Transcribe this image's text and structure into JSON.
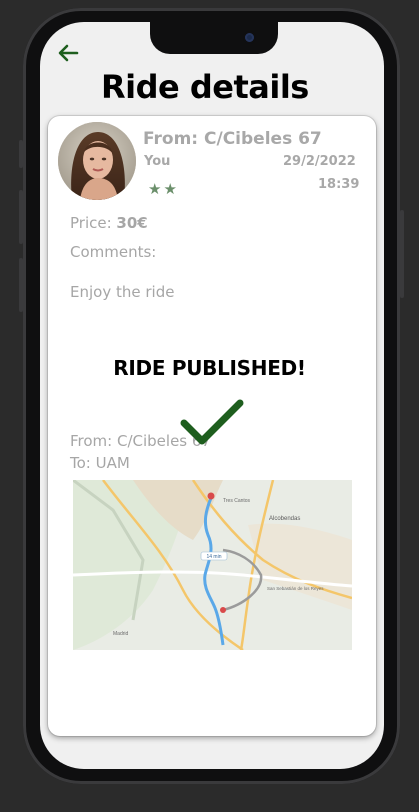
{
  "header": {
    "title": "Ride details"
  },
  "ride": {
    "from_title": "From: C/Cibeles 67",
    "driver": "You",
    "date": "29/2/2022",
    "time": "18:39",
    "stars": "★★",
    "price_label": "Price: ",
    "price_value": "30€",
    "comments_label": "Comments:",
    "comments": "Enjoy the ride",
    "from": "From: C/Cibeles 67",
    "to": "To: UAM"
  },
  "overlay": {
    "message": "RIDE PUBLISHED!"
  },
  "icons": {
    "back": "arrow-left-icon",
    "success": "checkmark-icon"
  },
  "colors": {
    "accent": "#1e5e1e",
    "star": "#6b8f6b",
    "muted_text": "#a6a6a6"
  },
  "map_labels": {
    "label_1": "Tres Cantos",
    "label_2": "Alcobendas",
    "label_3": "San Sebastián de los Reyes",
    "label_4": "Madrid",
    "label_5": "14 min"
  }
}
